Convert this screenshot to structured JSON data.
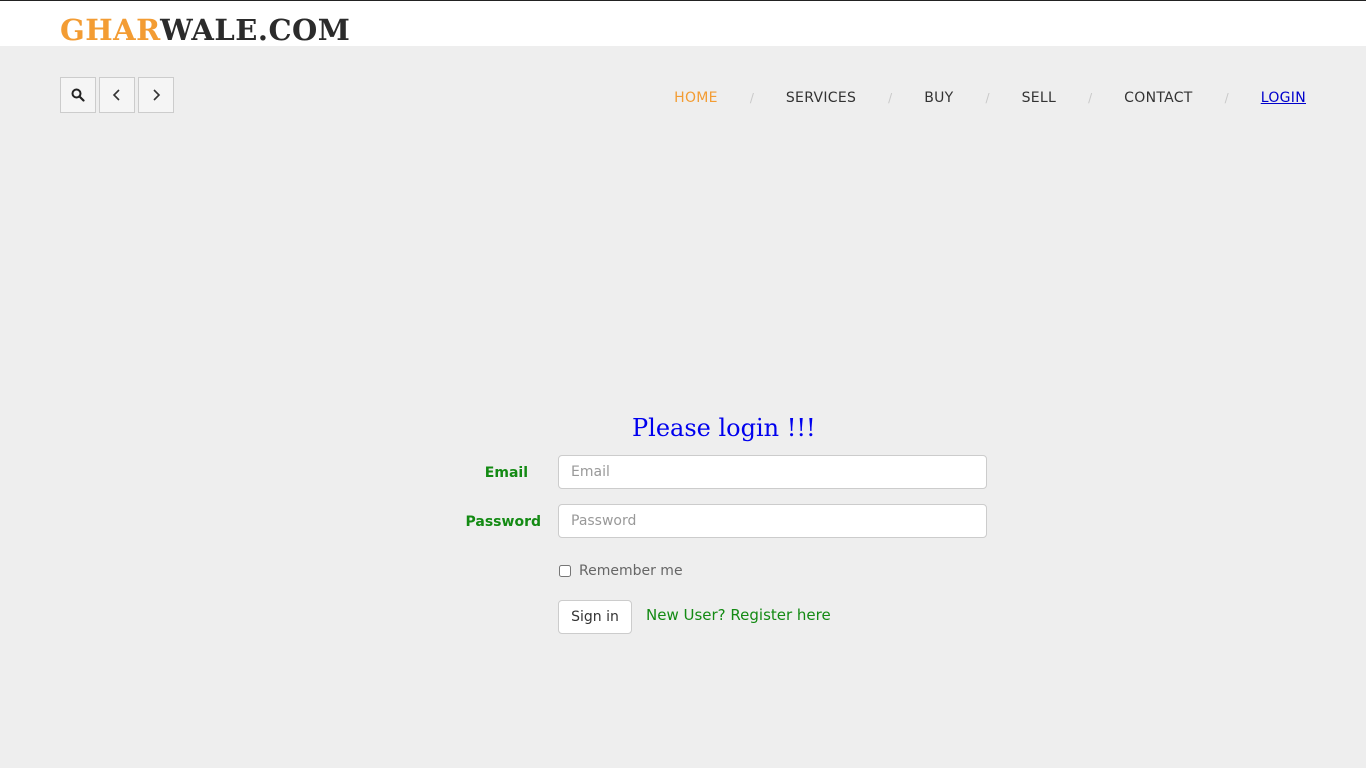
{
  "brand": {
    "part1": "GHAR",
    "part2": "WALE.COM",
    "accent_color": "#f39c33"
  },
  "toolbar": {
    "search_icon": "search-icon",
    "back_icon": "chevron-left-icon",
    "forward_icon": "chevron-right-icon"
  },
  "nav": {
    "separator": "/",
    "items": [
      "HOME",
      "SERVICES",
      "BUY",
      "SELL",
      "CONTACT",
      "LOGIN"
    ],
    "active": "HOME"
  },
  "login": {
    "title": "Please login !!!",
    "email_label": "Email",
    "email_placeholder": "Email",
    "password_label": "Password",
    "password_placeholder": "Password",
    "remember_label": "Remember me",
    "signin_label": "Sign in",
    "register_link": "New User? Register here"
  }
}
